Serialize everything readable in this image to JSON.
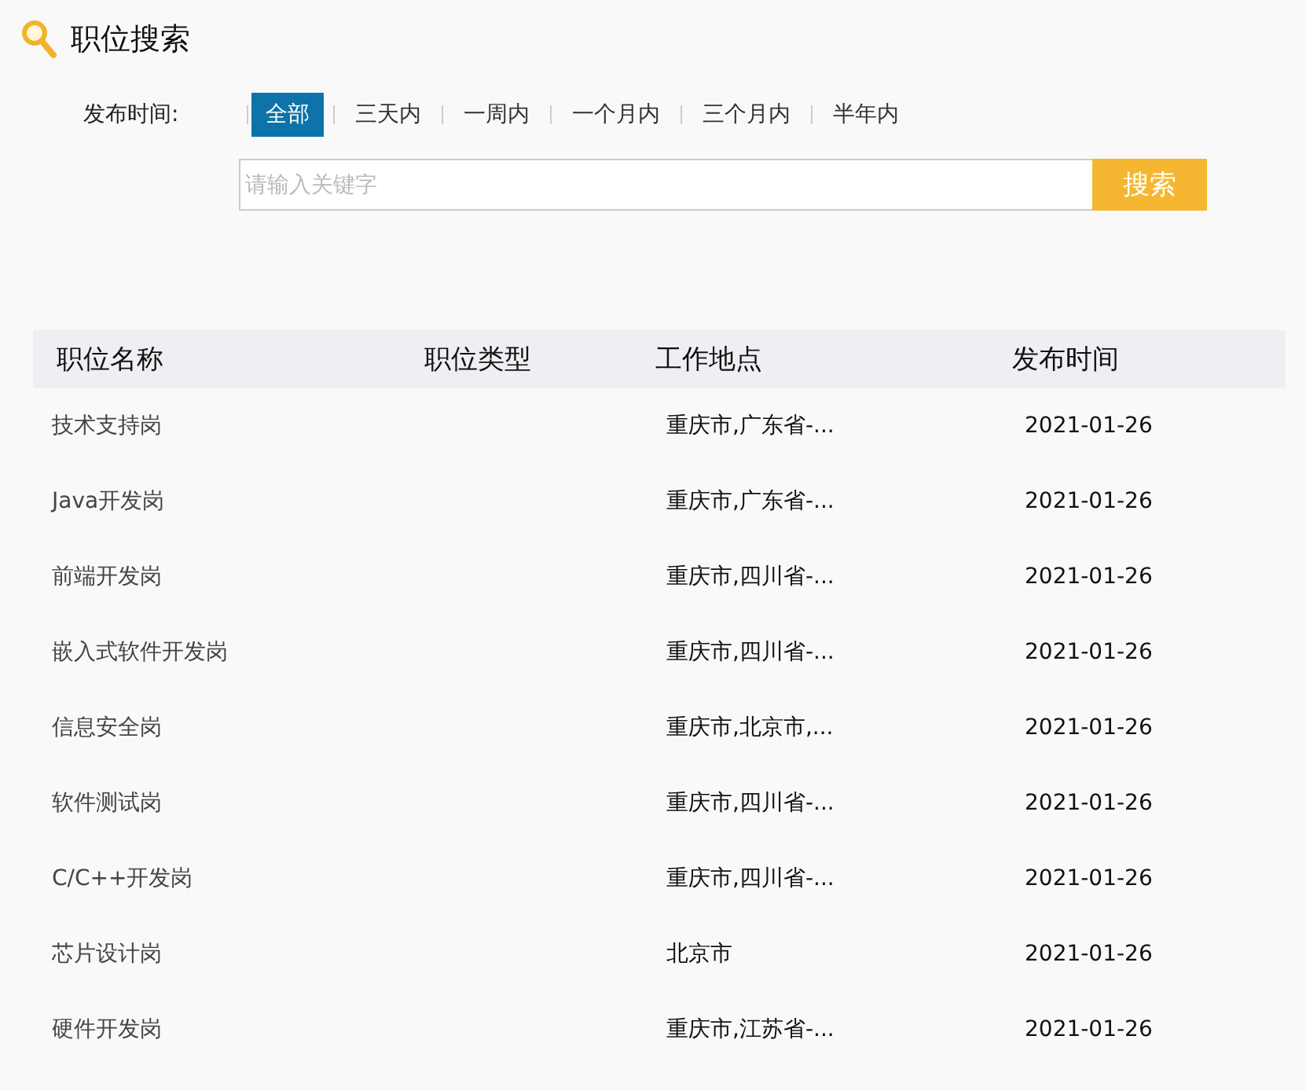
{
  "title": "职位搜索",
  "filter": {
    "label": "发布时间:",
    "options": [
      {
        "label": "全部",
        "selected": true
      },
      {
        "label": "三天内",
        "selected": false
      },
      {
        "label": "一周内",
        "selected": false
      },
      {
        "label": "一个月内",
        "selected": false
      },
      {
        "label": "三个月内",
        "selected": false
      },
      {
        "label": "半年内",
        "selected": false
      }
    ]
  },
  "search": {
    "placeholder": "请输入关键字",
    "button": "搜索"
  },
  "table": {
    "columns": [
      "职位名称",
      "职位类型",
      "工作地点",
      "发布时间"
    ],
    "rows": [
      [
        "技术支持岗",
        "",
        "重庆市,广东省-...",
        "2021-01-26"
      ],
      [
        "Java开发岗",
        "",
        "重庆市,广东省-...",
        "2021-01-26"
      ],
      [
        "前端开发岗",
        "",
        "重庆市,四川省-...",
        "2021-01-26"
      ],
      [
        "嵌入式软件开发岗",
        "",
        "重庆市,四川省-...",
        "2021-01-26"
      ],
      [
        "信息安全岗",
        "",
        "重庆市,北京市,...",
        "2021-01-26"
      ],
      [
        "软件测试岗",
        "",
        "重庆市,四川省-...",
        "2021-01-26"
      ],
      [
        "C/C++开发岗",
        "",
        "重庆市,四川省-...",
        "2021-01-26"
      ],
      [
        "芯片设计岗",
        "",
        "北京市",
        "2021-01-26"
      ],
      [
        "硬件开发岗",
        "",
        "重庆市,江苏省-...",
        "2021-01-26"
      ]
    ]
  }
}
